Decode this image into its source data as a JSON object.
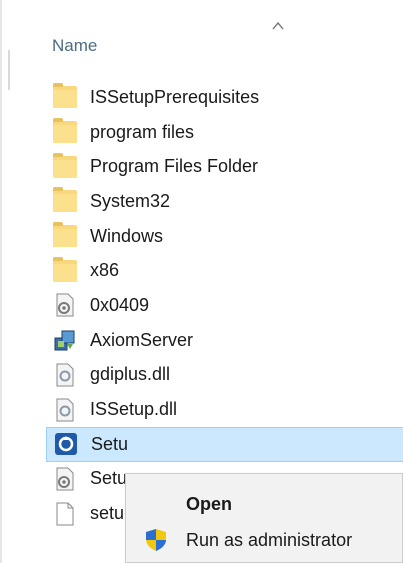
{
  "header": {
    "name_column": "Name"
  },
  "files": [
    {
      "name": "ISSetupPrerequisites",
      "icon": "folder-icon"
    },
    {
      "name": "program files",
      "icon": "folder-icon"
    },
    {
      "name": "Program Files Folder",
      "icon": "folder-icon"
    },
    {
      "name": "System32",
      "icon": "folder-icon"
    },
    {
      "name": "Windows",
      "icon": "folder-icon"
    },
    {
      "name": "x86",
      "icon": "folder-icon"
    },
    {
      "name": "0x0409",
      "icon": "settings-file-icon"
    },
    {
      "name": "AxiomServer",
      "icon": "installer-icon"
    },
    {
      "name": "gdiplus.dll",
      "icon": "dll-file-icon"
    },
    {
      "name": "ISSetup.dll",
      "icon": "dll-file-icon"
    },
    {
      "name": "Setu",
      "icon": "setup-exe-icon",
      "selected": true
    },
    {
      "name": "Setu",
      "icon": "settings-file-icon"
    },
    {
      "name": "setu",
      "icon": "blank-file-icon"
    }
  ],
  "context_menu": {
    "open_label": "Open",
    "run_as_admin_label": "Run as administrator",
    "shield_icon": "uac-shield-icon"
  },
  "colors": {
    "selection_bg": "#cce8ff",
    "selection_border": "#99d1ff",
    "header_text": "#4d6b86",
    "folder": "#f9d77c"
  }
}
